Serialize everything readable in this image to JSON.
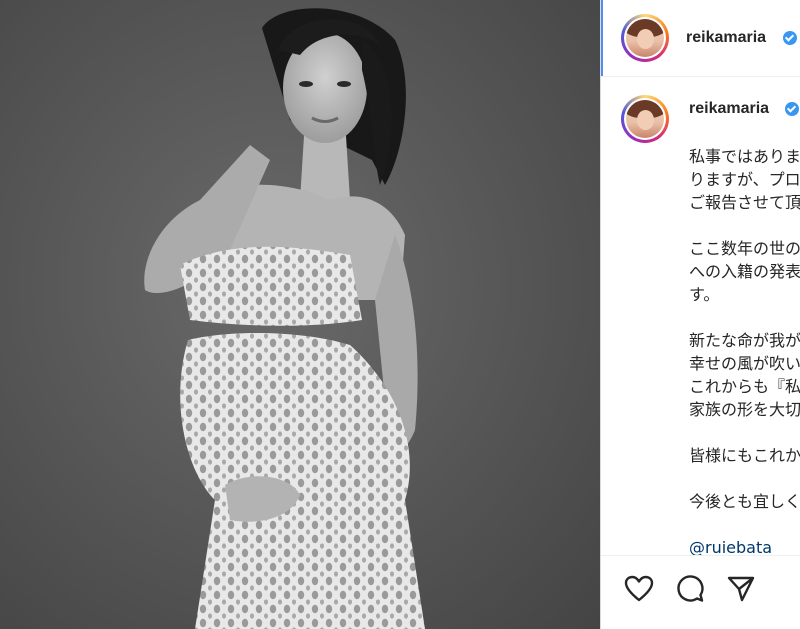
{
  "post": {
    "username": "reikamaria",
    "caption_lines": [
      "私事ではありま",
      "りますが、プロ",
      "ご報告させて頂",
      "",
      "ここ数年の世の",
      "への入籍の発表",
      "す。",
      "",
      "新たな命が我が",
      "幸せの風が吹い",
      "これからも『私",
      "家族の形を大切",
      "",
      "皆様にもこれか",
      "",
      "今後とも宜しく"
    ],
    "mention": "@ruiebata"
  },
  "icons": {
    "verified": "verified-badge-icon",
    "like": "heart-icon",
    "comment": "comment-bubble-icon",
    "share": "paper-plane-icon"
  },
  "colors": {
    "verified": "#3897f0",
    "text": "#262626",
    "mention": "#00376b"
  }
}
